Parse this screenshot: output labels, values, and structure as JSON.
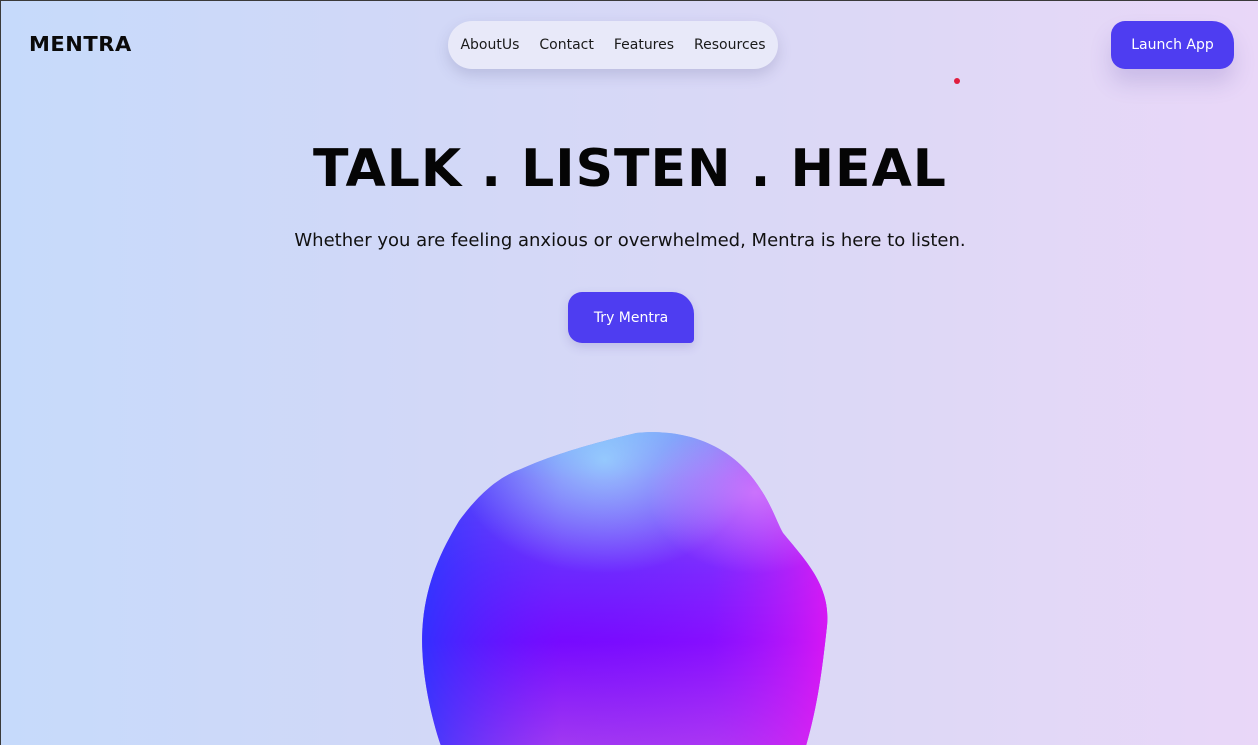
{
  "brand": {
    "logo_text": "MENTRA"
  },
  "nav": {
    "items": [
      {
        "label": "AboutUs"
      },
      {
        "label": "Contact"
      },
      {
        "label": "Features"
      },
      {
        "label": "Resources"
      }
    ]
  },
  "header": {
    "launch_label": "Launch App"
  },
  "hero": {
    "headline": "TALK . LISTEN . HEAL",
    "subtitle": "Whether you are feeling anxious or overwhelmed, Mentra is here to listen.",
    "cta_label": "Try Mentra"
  },
  "colors": {
    "accent": "#4e3df1",
    "background_left": "#c6dafb",
    "background_right": "#e9d7f8",
    "dot": "#e01d3f",
    "blob_top": "#5fb0f5",
    "blob_mid": "#7a08ff",
    "blob_right": "#e010f5"
  },
  "decor": {
    "blob": "gradient-orb"
  }
}
